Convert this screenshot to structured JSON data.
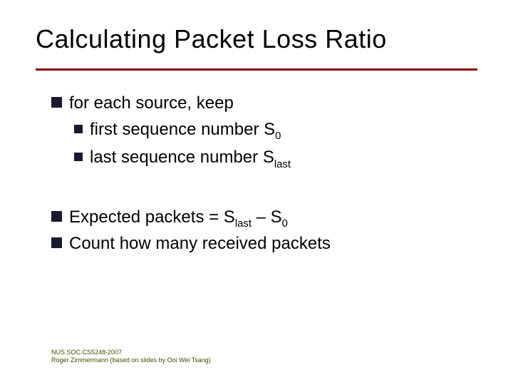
{
  "title": "Calculating Packet Loss Ratio",
  "bullets": {
    "b1": "for each source, keep",
    "b1a_pre": "first sequence number S",
    "b1a_sub": "0",
    "b1b_pre": "last sequence number S",
    "b1b_sub": "last",
    "b2_pre1": "Expected packets = S",
    "b2_sub1": "last",
    "b2_mid": " – S",
    "b2_sub2": "0",
    "b3": "Count how many received packets"
  },
  "footer": {
    "line1": "NUS.SOC.CS5248-2007",
    "line2": "Roger Zimmermann (based on slides by Ooi Wei Tsang)"
  }
}
